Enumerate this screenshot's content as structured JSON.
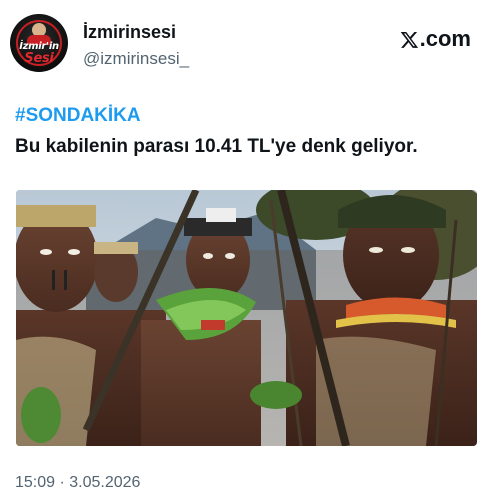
{
  "header": {
    "display_name": "İzmirinsesi",
    "handle": "@izmirinsesi_",
    "avatar_text_line1": "İzmir'in",
    "avatar_text_line2": "Sesi",
    "platform_label": ".com",
    "platform_icon": "x-logo-icon"
  },
  "tweet": {
    "hashtag": "#SONDAKİKA",
    "text": "Bu kabilenin parası 10.41 TL'ye denk geliyor.",
    "timestamp": "15:09 · 3.05.2026"
  },
  "colors": {
    "link": "#1d9bf0",
    "text": "#0f1419",
    "secondary": "#536471",
    "brand_red": "#c71f24"
  }
}
